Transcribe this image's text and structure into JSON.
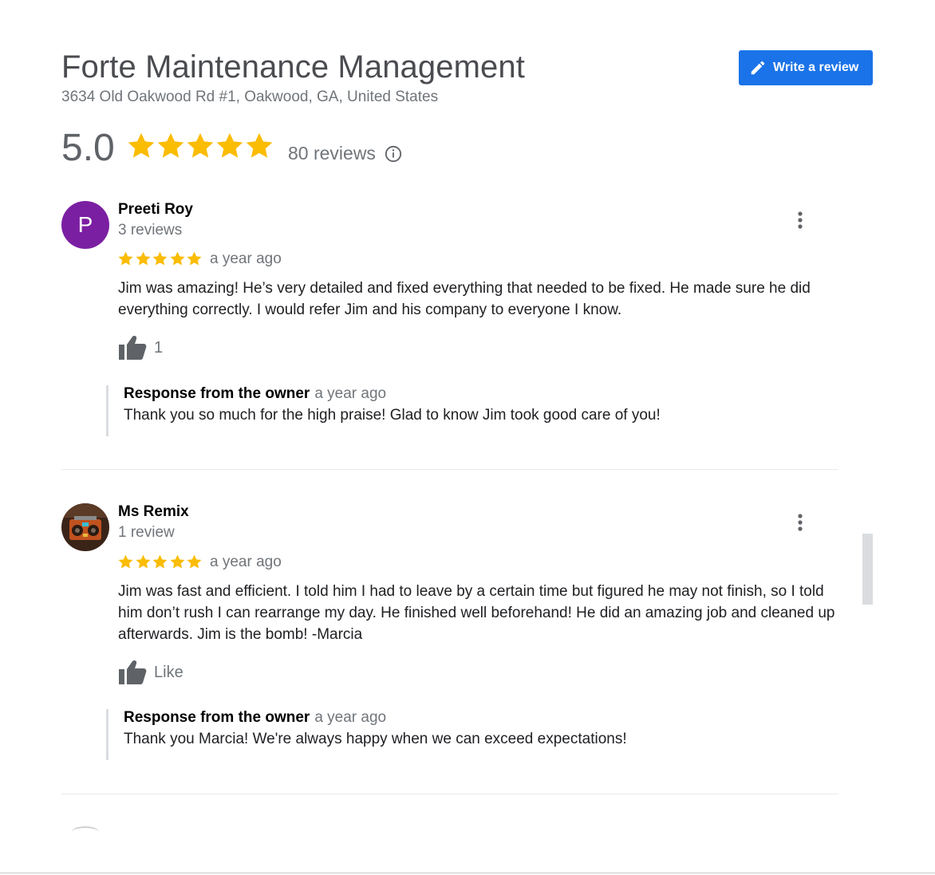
{
  "business": {
    "name": "Forte Maintenance Management",
    "address": "3634 Old Oakwood Rd #1, Oakwood, GA, United States",
    "rating": "5.0",
    "stars": 5,
    "reviews_count": "80 reviews",
    "write_review_label": "Write a review",
    "star_color": "#fbbc04",
    "button_color": "#1a73e8"
  },
  "reviews": [
    {
      "avatar_letter": "P",
      "avatar_color": "#7b1fa2",
      "author": "Preeti Roy",
      "author_sub": "3 reviews",
      "stars": 5,
      "time": "a year ago",
      "text": "Jim was amazing! He’s very detailed and fixed everything that needed to be fixed. He made sure he did everything correctly. I would refer Jim and his company to everyone I know.",
      "like_label": "1",
      "owner_label": "Response from the owner",
      "owner_time": "a year ago",
      "owner_text": "Thank you so much for the high praise! Glad to know Jim took good care of you!"
    },
    {
      "avatar_image": "boombox",
      "author": "Ms Remix",
      "author_sub": "1 review",
      "stars": 5,
      "time": "a year ago",
      "text": "Jim was fast and  efficient. I told him I had to leave by a certain time but figured he may not finish, so I told him don’t rush I can rearrange my day. He finished well beforehand! He did an amazing job and cleaned up afterwards. Jim is the bomb! -Marcia",
      "like_label": "Like",
      "owner_label": "Response from the owner",
      "owner_time": "a year ago",
      "owner_text": "Thank you Marcia! We're always happy when we can exceed expectations!"
    }
  ]
}
